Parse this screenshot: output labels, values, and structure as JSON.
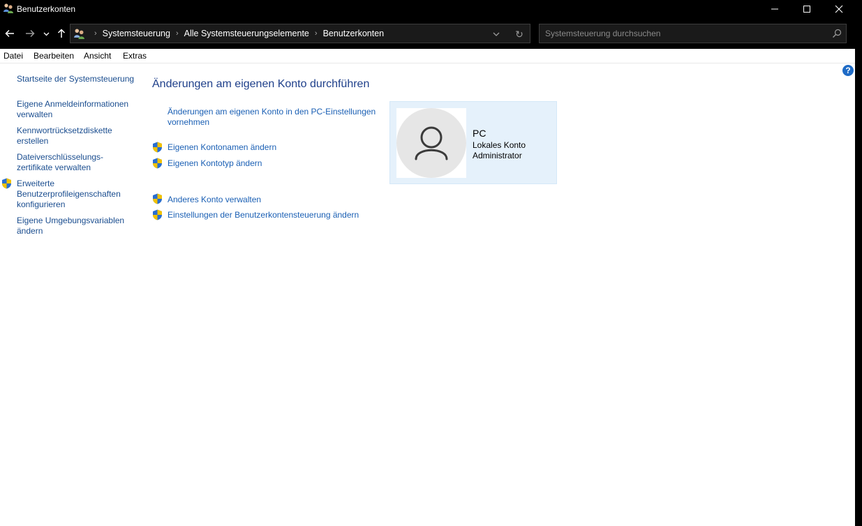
{
  "window": {
    "title": "Benutzerkonten"
  },
  "address": {
    "crumbs": [
      "Systemsteuerung",
      "Alle Systemsteuerungselemente",
      "Benutzerkonten"
    ],
    "refresh_glyph": "↻"
  },
  "search": {
    "placeholder": "Systemsteuerung durchsuchen"
  },
  "menu": {
    "items": [
      "Datei",
      "Bearbeiten",
      "Ansicht",
      "Extras"
    ]
  },
  "sidebar": {
    "items": [
      {
        "label": "Startseite der Systemsteuerung",
        "shield": false
      },
      {
        "label": "Eigene Anmeldeinformationen verwalten",
        "shield": false
      },
      {
        "label": "Kennwortrücksetzdiskette erstellen",
        "shield": false
      },
      {
        "label": "Dateiverschlüsselungs-zertifikate verwalten",
        "shield": false
      },
      {
        "label": "Erweiterte Benutzerprofileigenschaften konfigurieren",
        "shield": true
      },
      {
        "label": "Eigene Umgebungsvariablen ändern",
        "shield": false
      }
    ]
  },
  "main": {
    "title": "Änderungen am eigenen Konto durchführen",
    "tasks": [
      {
        "label": "Änderungen am eigenen Konto in den PC-Einstellungen vornehmen",
        "shield": false
      },
      {
        "label": "Eigenen Kontonamen ändern",
        "shield": true
      },
      {
        "label": "Eigenen Kontotyp ändern",
        "shield": true
      },
      {
        "label": "Anderes Konto verwalten",
        "shield": true
      },
      {
        "label": "Einstellungen der Benutzerkontensteuerung ändern",
        "shield": true
      }
    ]
  },
  "account": {
    "name": "PC",
    "type": "Lokales Konto",
    "role": "Administrator"
  },
  "help": {
    "glyph": "?"
  },
  "colors": {
    "link": "#1a5fb4",
    "title": "#1e3f8a",
    "card_bg": "#e5f1fb",
    "uac_blue": "#2a6fd1",
    "uac_yellow": "#f2c200"
  }
}
